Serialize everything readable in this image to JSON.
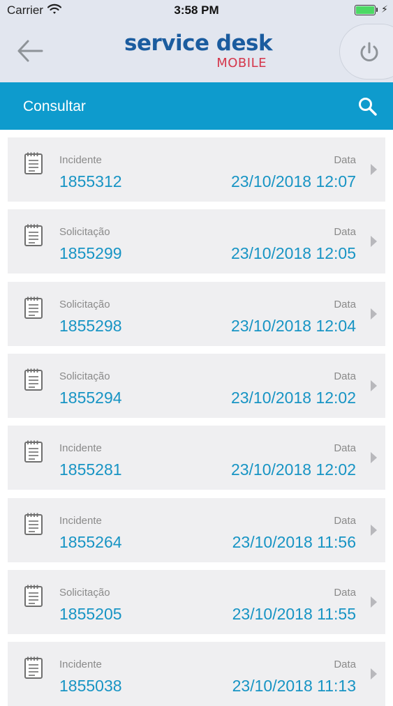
{
  "status_bar": {
    "carrier": "Carrier",
    "time": "3:58 PM",
    "battery_level": 1.0
  },
  "header": {
    "logo_main": "service desk",
    "logo_sub": "MOBILE",
    "back_icon": "arrow-left-icon",
    "power_icon": "power-icon"
  },
  "title_bar": {
    "title": "Consultar",
    "search_icon": "search-icon"
  },
  "list": {
    "items": [
      {
        "type": "Incidente",
        "number": "1855312",
        "date_label": "Data",
        "date": "23/10/2018 12:07"
      },
      {
        "type": "Solicitação",
        "number": "1855299",
        "date_label": "Data",
        "date": "23/10/2018 12:05"
      },
      {
        "type": "Solicitação",
        "number": "1855298",
        "date_label": "Data",
        "date": "23/10/2018 12:04"
      },
      {
        "type": "Solicitação",
        "number": "1855294",
        "date_label": "Data",
        "date": "23/10/2018 12:02"
      },
      {
        "type": "Incidente",
        "number": "1855281",
        "date_label": "Data",
        "date": "23/10/2018 12:02"
      },
      {
        "type": "Incidente",
        "number": "1855264",
        "date_label": "Data",
        "date": "23/10/2018 11:56"
      },
      {
        "type": "Solicitação",
        "number": "1855205",
        "date_label": "Data",
        "date": "23/10/2018 11:55"
      },
      {
        "type": "Incidente",
        "number": "1855038",
        "date_label": "Data",
        "date": "23/10/2018 11:13"
      }
    ]
  },
  "colors": {
    "accent": "#0e9bcd",
    "value_text": "#1794c4",
    "logo_blue": "#1b5c9f",
    "logo_red": "#d5374c"
  }
}
